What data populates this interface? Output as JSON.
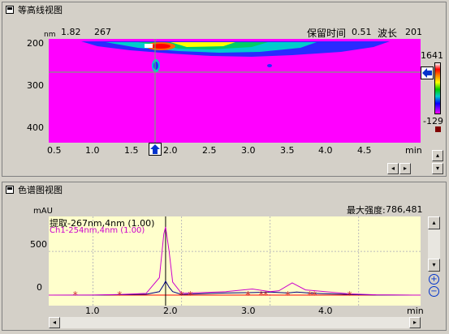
{
  "contour": {
    "title": "等高线视图",
    "nm_label": "nm",
    "cursor_x": "1.82",
    "cursor_y": "267",
    "retention_label": "保留时间",
    "retention_value": "0.51",
    "wavelength_label": "波长",
    "wavelength_value": "201",
    "y_ticks": [
      "200",
      "300",
      "400"
    ],
    "x_ticks": [
      "0.5",
      "1.0",
      "1.5",
      "2.0",
      "2.5",
      "3.0",
      "3.5",
      "4.0",
      "4.5"
    ],
    "x_unit": "min",
    "scale_max": "1641",
    "scale_min": "-129",
    "colors": {
      "background": "#ff00ff",
      "crosshair": "#66bb66"
    }
  },
  "chrom": {
    "title": "色谱图视图",
    "y_unit": "mAU",
    "max_intensity_label": "最大强度:",
    "max_intensity_value": "786,481",
    "legend_extract": "提取-267nm,4nm (1.00)",
    "legend_ch1": "Ch1-254nm,4nm (1.00)",
    "y_ticks": [
      "500",
      "0"
    ],
    "x_ticks": [
      "1.0",
      "2.0",
      "3.0",
      "4.0"
    ],
    "x_unit": "min",
    "colors": {
      "plot_bg": "#ffffcc",
      "extract": "#000080",
      "ch1": "#cc00cc",
      "baseline": "#ff0000"
    }
  },
  "chart_data": [
    {
      "type": "heatmap",
      "title": "等高线视图",
      "xlabel": "min",
      "ylabel": "nm",
      "xlim": [
        0.5,
        4.7
      ],
      "ylim": [
        190,
        440
      ],
      "scale": [
        -129,
        1641
      ],
      "cursor": {
        "x": 1.82,
        "y": 267
      }
    },
    {
      "type": "line",
      "title": "色谱图视图",
      "ylabel": "mAU",
      "xlabel": "min",
      "xlim": [
        0.5,
        4.7
      ],
      "ylim": [
        -120,
        900
      ],
      "series": [
        {
          "name": "提取-267nm,4nm (1.00)",
          "x": [
            0.5,
            1.0,
            1.3,
            1.6,
            1.75,
            1.8,
            1.82,
            1.86,
            1.9,
            2.0,
            2.5,
            2.8,
            3.0,
            3.2,
            3.3,
            3.5,
            3.9,
            4.2,
            4.7
          ],
          "y": [
            0,
            0,
            5,
            10,
            40,
            120,
            160,
            90,
            40,
            8,
            25,
            30,
            35,
            25,
            35,
            20,
            8,
            2,
            0
          ]
        },
        {
          "name": "Ch1-254nm,4nm (1.00)",
          "x": [
            0.5,
            1.0,
            1.3,
            1.6,
            1.75,
            1.8,
            1.82,
            1.86,
            1.9,
            2.0,
            2.5,
            2.8,
            3.0,
            3.1,
            3.25,
            3.4,
            3.9,
            4.2,
            4.7
          ],
          "y": [
            0,
            2,
            8,
            20,
            200,
            700,
            780,
            500,
            150,
            20,
            40,
            70,
            40,
            50,
            140,
            60,
            15,
            4,
            0
          ]
        }
      ],
      "peak_markers_x": [
        0.8,
        1.3,
        2.0,
        2.1,
        2.75,
        2.75,
        2.9,
        2.95,
        3.2,
        3.45,
        3.5,
        3.9,
        4.9
      ]
    }
  ]
}
